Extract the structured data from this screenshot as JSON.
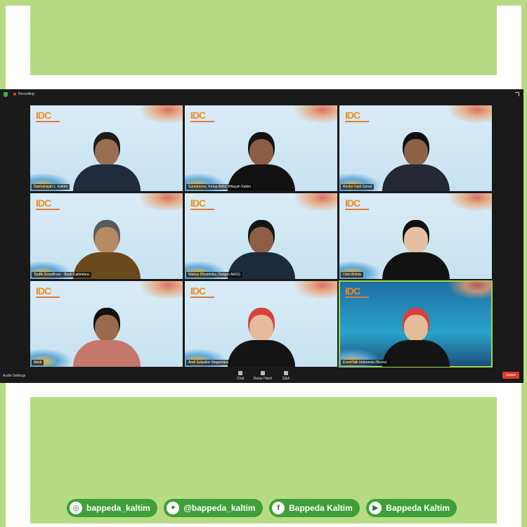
{
  "zoom": {
    "recording_label": "Recording",
    "audio_settings_label": "Audio Settings",
    "controls": [
      {
        "label": "Chat"
      },
      {
        "label": "Raise Hand"
      },
      {
        "label": "Q&A"
      }
    ],
    "leave_label": "Leave",
    "logo_text": "IDC",
    "participants": [
      {
        "name": "Darmansjah L. Kahim",
        "shirt": "#1f2a3d",
        "skin": "#9b6d50",
        "hair": "#1b1b1b"
      },
      {
        "name": "Sumarsono, Ketua AMSI Wilayah Kaltim",
        "shirt": "#111111",
        "skin": "#8a5e44",
        "hair": "#111111"
      },
      {
        "name": "Rector Iradi Zainal",
        "shirt": "#232833",
        "skin": "#8b6148",
        "hair": "#111111"
      },
      {
        "name": "Taufik Ginadtman - Bank Kaltimtara",
        "shirt": "#6a4a1c",
        "skin": "#b68a63",
        "hair": "#5a5a5a"
      },
      {
        "name": "Wahyu Dhyatmika (Sekjen AMSI)",
        "shirt": "#1b2b3b",
        "skin": "#8c5e43",
        "hair": "#141414"
      },
      {
        "name": "Utari Arlinta",
        "shirt": "#121212",
        "skin": "#e6c0a3",
        "hair": "#111111"
      },
      {
        "name": "Abidi",
        "shirt": "#c4776a",
        "skin": "#9a6a4c",
        "hair": "#111111"
      },
      {
        "name": "Andi Sulasikin Magantara",
        "shirt": "#141414",
        "skin": "#e4bb9b",
        "hair": "#d8403b"
      },
      {
        "name": "EventTalk Indonesia (Bisnis)",
        "shirt": "#141414",
        "skin": "#e4bb9b",
        "hair": "#d8403b"
      }
    ]
  },
  "social": [
    {
      "icon": "instagram-icon",
      "glyph": "◎",
      "label": "bappeda_kaltim"
    },
    {
      "icon": "twitter-icon",
      "glyph": "✦",
      "label": "@bappeda_kaltim"
    },
    {
      "icon": "facebook-icon",
      "glyph": "f",
      "label": "Bappeda Kaltim"
    },
    {
      "icon": "youtube-icon",
      "glyph": "▶",
      "label": "Bappeda Kaltim"
    }
  ],
  "colors": {
    "frame_green": "#b7db82",
    "pill_green": "#3f9f3a",
    "leave_red": "#d63a2d",
    "active_outline": "#9fd64a"
  }
}
